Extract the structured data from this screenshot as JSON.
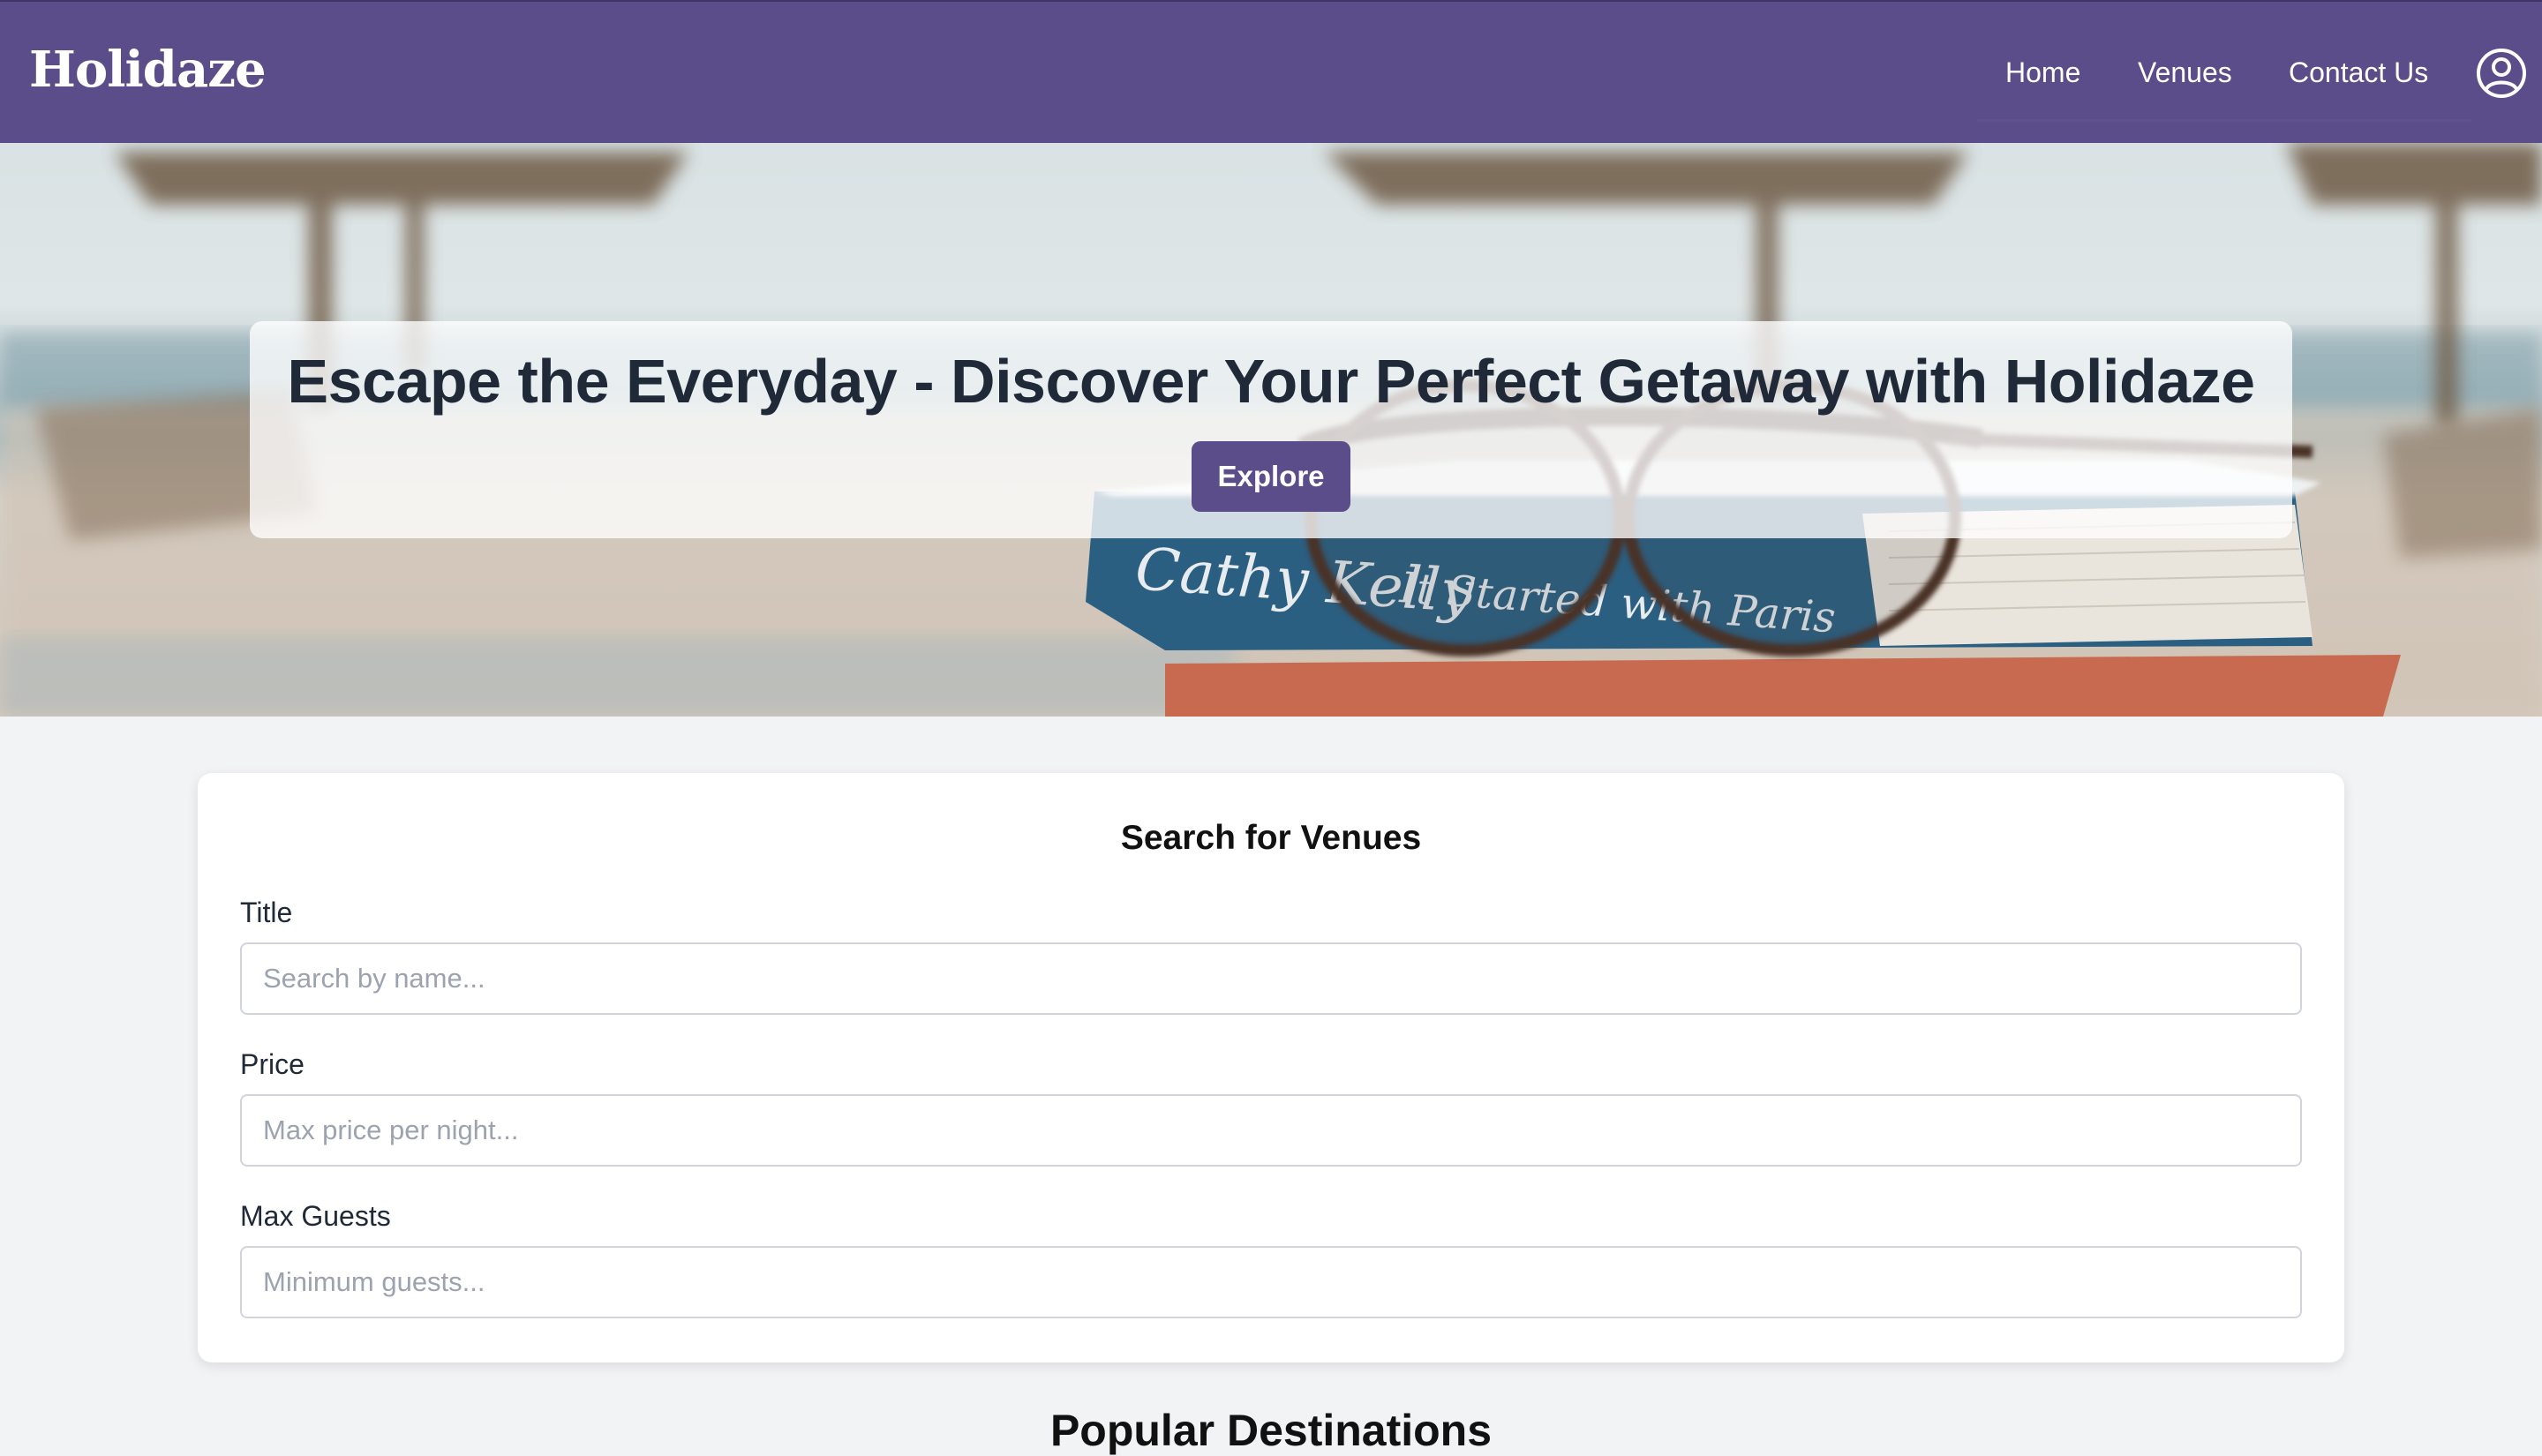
{
  "brand": {
    "logo": "Holidaze",
    "primary_color": "#5b4d8a"
  },
  "nav": {
    "links": [
      {
        "label": "Home"
      },
      {
        "label": "Venues"
      },
      {
        "label": "Contact Us"
      }
    ],
    "profile_icon": "user-circle-icon"
  },
  "hero": {
    "title": "Escape the Everyday - Discover Your Perfect Getaway with Holidaze",
    "cta_label": "Explore",
    "image_text": {
      "author": "Cathy Kelly",
      "book_title": "It Started with Paris"
    }
  },
  "search": {
    "heading": "Search for Venues",
    "fields": [
      {
        "label": "Title",
        "placeholder": "Search by name..."
      },
      {
        "label": "Price",
        "placeholder": "Max price per night..."
      },
      {
        "label": "Max Guests",
        "placeholder": "Minimum guests..."
      }
    ]
  },
  "sections": {
    "popular_heading": "Popular Destinations"
  }
}
